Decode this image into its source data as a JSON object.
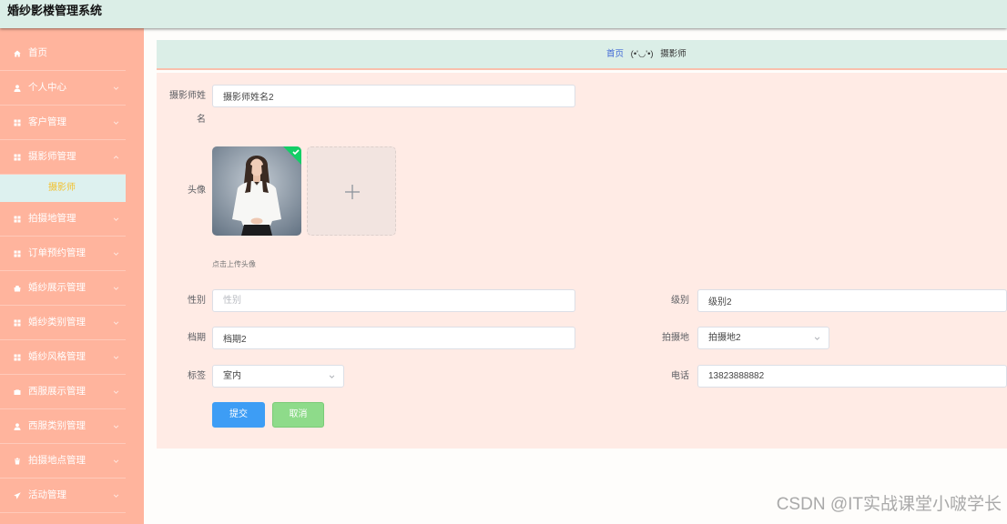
{
  "theme": {
    "page_bg": "#fefdfb",
    "header_bg": "#dbeee7",
    "sidebar_bg": "#ffb49d",
    "sidebar_active_bg": "#ddf1ef",
    "sidebar_active_text": "#f2c12e",
    "breadcrumb_bg": "#dbeee7",
    "form_bg": "#ffebe5",
    "primary": "#3d9df5",
    "cancel": "#8edb8a",
    "link": "#4169d6"
  },
  "header": {
    "title": "婚纱影楼管理系统"
  },
  "sidebar": {
    "items": [
      {
        "label": "首页",
        "icon": "home-icon"
      },
      {
        "label": "个人中心",
        "icon": "user-icon"
      },
      {
        "label": "客户管理",
        "icon": "grid-icon"
      },
      {
        "label": "摄影师管理",
        "icon": "grid-icon",
        "expanded": true,
        "children": [
          {
            "label": "摄影师",
            "active": true
          }
        ]
      },
      {
        "label": "拍摄地管理",
        "icon": "grid-icon"
      },
      {
        "label": "订单预约管理",
        "icon": "grid-icon"
      },
      {
        "label": "婚纱展示管理",
        "icon": "goods-icon"
      },
      {
        "label": "婚纱类别管理",
        "icon": "grid-icon"
      },
      {
        "label": "婚纱风格管理",
        "icon": "grid-icon"
      },
      {
        "label": "西服展示管理",
        "icon": "briefcase-icon"
      },
      {
        "label": "西服类别管理",
        "icon": "user-icon"
      },
      {
        "label": "拍摄地点管理",
        "icon": "bin-icon"
      },
      {
        "label": "活动管理",
        "icon": "send-icon"
      }
    ]
  },
  "breadcrumb": {
    "home": "首页",
    "separator": "(•'◡'•)",
    "current": "摄影师"
  },
  "form": {
    "name": {
      "label": "摄影师姓名",
      "value": "摄影师姓名2"
    },
    "avatar": {
      "label": "头像",
      "tip": "点击上传头像",
      "upload_icon": "plus-icon",
      "status_icon": "check-icon"
    },
    "gender": {
      "label": "性别",
      "placeholder": "性别"
    },
    "level": {
      "label": "级别",
      "value": "级别2"
    },
    "schedule": {
      "label": "档期",
      "value": "档期2"
    },
    "location": {
      "label": "拍摄地",
      "value": "拍摄地2"
    },
    "tag": {
      "label": "标签",
      "value": "室内"
    },
    "phone": {
      "label": "电话",
      "value": "13823888882"
    },
    "submit_label": "提交",
    "cancel_label": "取消"
  },
  "watermark": "CSDN @IT实战课堂小啵学长"
}
